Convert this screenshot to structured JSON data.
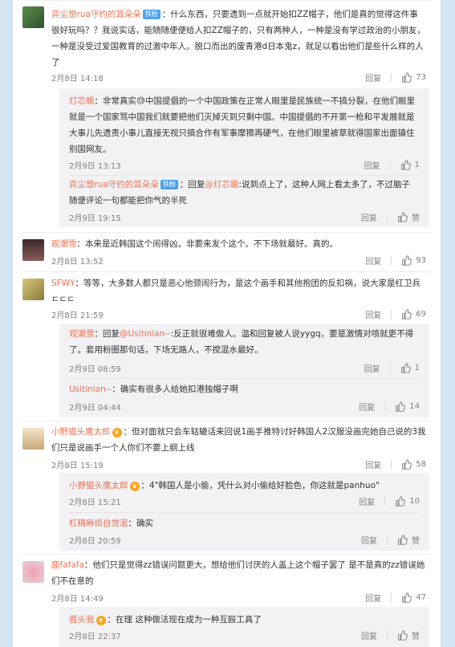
{
  "comments": [
    {
      "user": "弈尘想rua守约的耳朵朵",
      "badge": "铁粉",
      "text": "：什么东西，只要遗到一点就开始扣ZZ帽子，他们是真的觉得这件事很好玩吗？？我说实话，能随随便便给人扣ZZ帽子的，只有两种人，一种是没有学过政治的小朋友，一种是没受过爱国教育的过激中年人。脱口而出的废青港d日本鬼z，就足以看出他们是些什么样的人了",
      "time": "2月8日 14:18",
      "reply": "回复",
      "likes": "73"
    },
    {
      "user": "观潮雪",
      "text": "：本来是近韩国这个闹得凶，非要来发个这个。不下场就最好。真的。",
      "time": "2月8日 13:52",
      "reply": "回复",
      "likes": "93"
    },
    {
      "user": "SFWY",
      "text": "：等等，大多数人都只是恶心他颈闹行为，是这个画手和其他抱团的反扣祸，说大家是红卫兵ㄷㄷㄷ",
      "time": "2月8日 21:59",
      "reply": "回复",
      "likes": "69"
    },
    {
      "user": "小野猫头鹰太郎",
      "text": "：但对面就只会车轱辘话来回说1画手推特讨好韩国人2汉服没画完她自己说的3我们只是说画手一个人你们不要上纲上线",
      "time": "2月8日 15:19",
      "reply": "回复",
      "likes": "58"
    },
    {
      "user": "鹿fafafa",
      "text": "：他们只是觉得zz错误问题更大，想给他们讨厌的人盖上这个帽子罢了 是不是真的zz错误她们不在意的",
      "time": "2月8日 14:49",
      "reply": "回复",
      "likes": "47"
    }
  ],
  "replies": [
    {
      "user": "灯芯蛾",
      "text": "：非常真实😓中国提倡的一个中国政策在正常人眼里是民族统一不搞分裂，在他们眼里就是一个国家骂中国我们就要把他们灭掉灭到只剩中国。中国提倡的不开第一枪和平发展就是大事儿先遗责小事儿直接无视只搞合作有军事摩擦再硬气，在他们眼里被草就得国家出面镇住别国网友。",
      "time": "2月9日 13:13",
      "reply": "回复",
      "likes": "1"
    },
    {
      "user": "弈尘想rua守约的耳朵朵",
      "badge": "铁粉",
      "pre": "：回复",
      "mention": "@灯芯蛾",
      "text": ":说到点上了，这种人网上看太多了，不过脑子随便评论一句都能把你气的半死",
      "time": "2月9日 19:15",
      "reply": "回复",
      "likes": "赞"
    },
    {
      "user": "观潮雪",
      "pre": "：回复",
      "mention": "@Usitinian--",
      "text": ":反正就很难做人。温和回复被人说yygq，要是激情对喷就更不得了。套用粉圈那句话，下场无路人，不搅混水最好。",
      "time": "2月9日 08:59",
      "reply": "回复",
      "likes": "1"
    },
    {
      "user": "Usitinian--",
      "text": "：确实有很多人给她扣港独帽子啊",
      "time": "2月9日 04:44",
      "reply": "回复",
      "likes": "14"
    },
    {
      "user": "小野猫头鹰太郎",
      "text": "：4\"韩国人是小偷，凭什么对小偷给好脸色，你这就是panhuo\"",
      "time": "2月8日 15:21",
      "reply": "回复",
      "likes": "10"
    },
    {
      "user": "杠精麻烦自觉滚",
      "text": "：确实",
      "time": "2月8日 20:59",
      "reply": "回复",
      "likes": "赞"
    },
    {
      "user": "捱头我",
      "text": "：在理 这种做法现在成为一种互殴工具了",
      "time": "2月8日 22:37",
      "reply": "回复",
      "likes": "赞"
    }
  ],
  "icons": {
    "like": "thumbs-up-icon"
  },
  "colors": {
    "username": "#eb7350",
    "badge": "#4aa2f0",
    "background": "#d3e4f2"
  }
}
